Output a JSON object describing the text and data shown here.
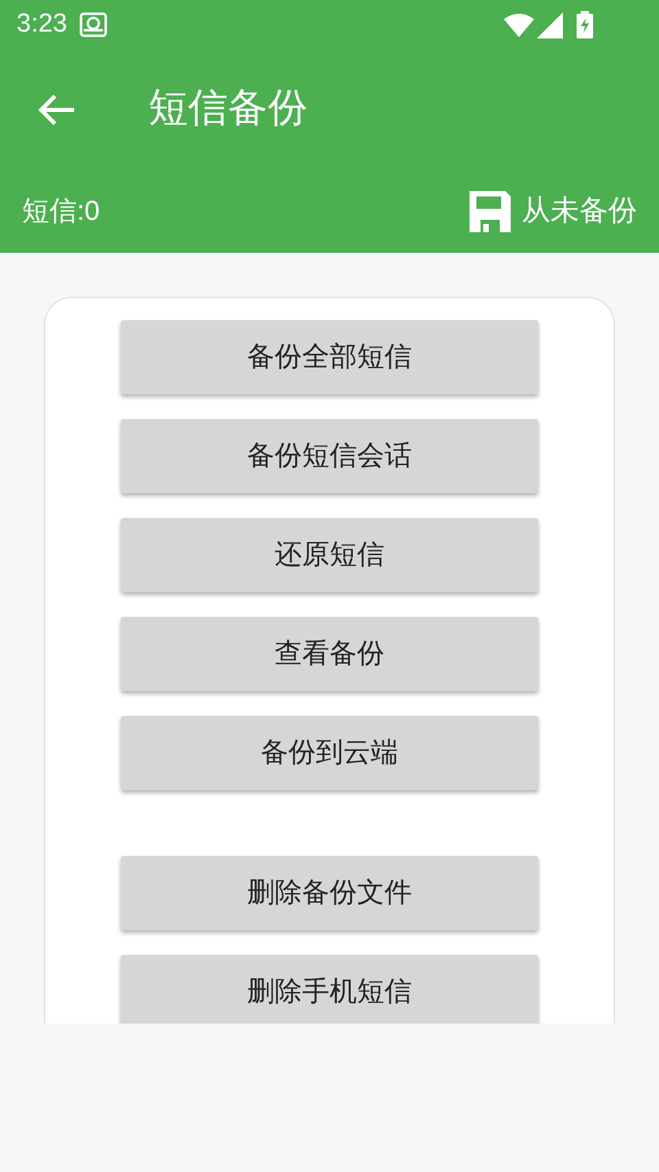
{
  "status_bar": {
    "time": "3:23"
  },
  "toolbar": {
    "title": "短信备份"
  },
  "info": {
    "count": "短信:0",
    "backup_status": "从未备份"
  },
  "button_groups": [
    {
      "buttons": [
        "备份全部短信",
        "备份短信会话",
        "还原短信",
        "查看备份",
        "备份到云端"
      ]
    },
    {
      "buttons": [
        "删除备份文件",
        "删除手机短信"
      ]
    }
  ]
}
